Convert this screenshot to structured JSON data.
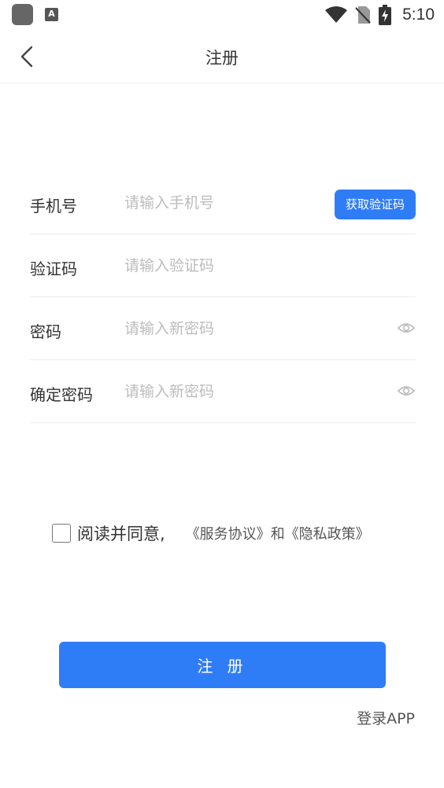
{
  "status_bar": {
    "app_icon": "app-square-icon",
    "a_badge": "A",
    "wifi_icon": "wifi-icon",
    "signal_icon": "no-signal-icon",
    "battery_icon": "battery-charging-icon",
    "time": "5:10"
  },
  "header": {
    "back_icon": "chevron-left-icon",
    "title": "注册"
  },
  "form": {
    "phone": {
      "label": "手机号",
      "placeholder": "请输入手机号"
    },
    "get_code_label": "获取验证码",
    "code": {
      "label": "验证码",
      "placeholder": "请输入验证码"
    },
    "password": {
      "label": "密码",
      "placeholder": "请输入新密码",
      "eye_icon": "eye-icon"
    },
    "confirm": {
      "label": "确定密码",
      "placeholder": "请输入新密码",
      "eye_icon": "eye-icon"
    }
  },
  "agreement": {
    "text": "阅读并同意,",
    "service": "《服务协议》",
    "and": "和",
    "privacy": "《隐私政策》"
  },
  "submit_label": "注 册",
  "login_link": "登录APP",
  "colors": {
    "accent": "#2f7df6",
    "placeholder": "#bcbcbc",
    "divider": "#ebebeb"
  }
}
